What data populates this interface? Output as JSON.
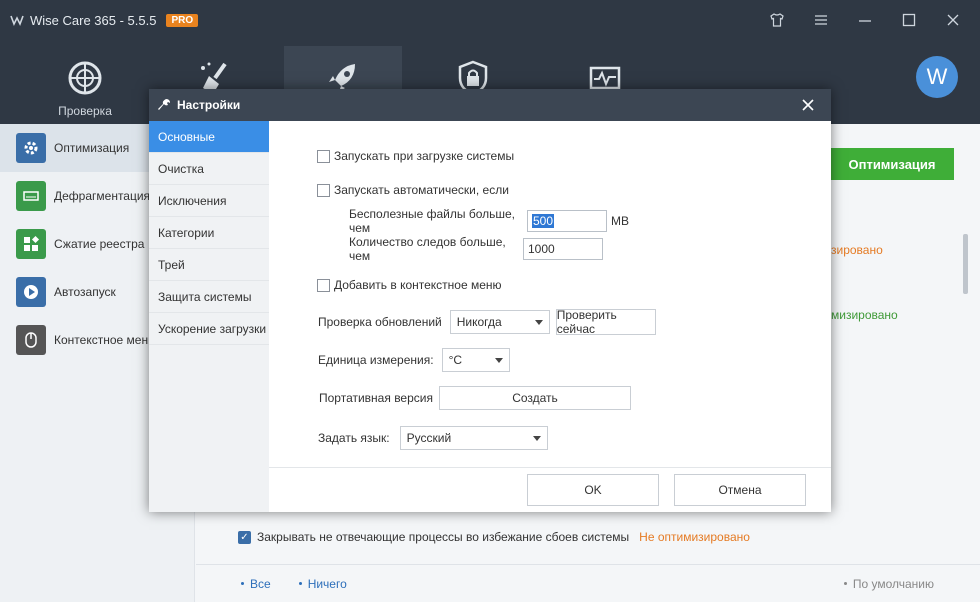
{
  "app": {
    "title": "Wise Care 365 - 5.5.5",
    "badge": "PRO",
    "avatar_letter": "W"
  },
  "window_controls": [
    "shirt-icon",
    "menu-icon",
    "minimize-icon",
    "maximize-icon",
    "close-icon"
  ],
  "toolbar": {
    "items": [
      {
        "label": "Проверка",
        "icon": "radar-icon"
      },
      {
        "label": "",
        "icon": "broom-icon"
      },
      {
        "label": "",
        "icon": "rocket-icon"
      },
      {
        "label": "",
        "icon": "privacy-lock-icon"
      },
      {
        "label": "",
        "icon": "monitor-icon"
      }
    ]
  },
  "sidebar": {
    "items": [
      {
        "label": "Оптимизация",
        "icon": "gear-icon",
        "color": "#3a6ea8"
      },
      {
        "label": "Дефрагментация",
        "icon": "disk-icon",
        "color": "#3a9a4a"
      },
      {
        "label": "Сжатие реестра",
        "icon": "blocks-icon",
        "color": "#3a9a4a"
      },
      {
        "label": "Автозапуск",
        "icon": "play-icon",
        "color": "#3a6ea8"
      },
      {
        "label": "Контекстное меню",
        "icon": "mouse-icon",
        "color": "#555555"
      }
    ]
  },
  "main": {
    "optimize_button": "Оптимизация",
    "status_1": "зировано",
    "status_2": "мизировано",
    "bottom_option": "Закрывать не отвечающие процессы во избежание сбоев системы",
    "bottom_status": "Не оптимизировано",
    "footer": {
      "all": "Все",
      "none": "Ничего",
      "default": "По умолчанию"
    }
  },
  "dialog": {
    "title": "Настройки",
    "nav": [
      "Основные",
      "Очистка",
      "Исключения",
      "Категории",
      "Трей",
      "Защита системы",
      "Ускорение загрузки"
    ],
    "startup_label": "Запускать при загрузке системы",
    "auto_label": "Запускать автоматически, если",
    "junk_label": "Бесполезные файлы больше, чем",
    "junk_value": "500",
    "junk_unit": "MB",
    "traces_label": "Количество следов больше, чем",
    "traces_value": "1000",
    "context_label": "Добавить в контекстное меню",
    "update_label": "Проверка обновлений",
    "update_value": "Никогда",
    "check_now": "Проверить сейчас",
    "unit_label": "Единица измерения:",
    "unit_value": "°C",
    "portable_label": "Портативная версия",
    "create_button": "Создать",
    "lang_label": "Задать язык:",
    "lang_value": "Русский",
    "ok": "OK",
    "cancel": "Отмена"
  }
}
